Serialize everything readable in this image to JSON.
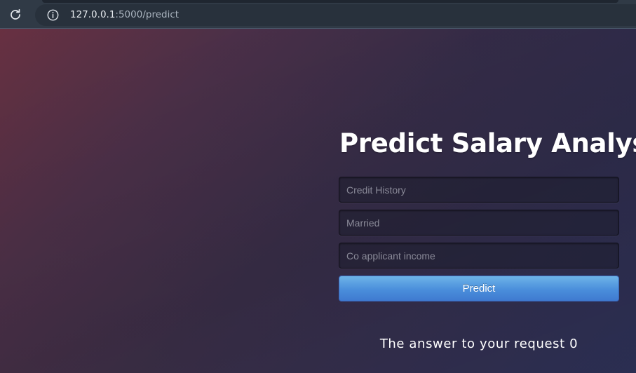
{
  "browser": {
    "url_host": "127.0.0.1",
    "url_path": ":5000/predict"
  },
  "page": {
    "title": "Predict Salary Analysis",
    "form": {
      "fields": [
        {
          "placeholder": "Credit History",
          "value": ""
        },
        {
          "placeholder": "Married",
          "value": ""
        },
        {
          "placeholder": "Co applicant income",
          "value": ""
        }
      ],
      "submit_label": "Predict"
    },
    "result_text": "The answer to your request 0"
  },
  "colors": {
    "button": "#4a8edb",
    "chrome": "#303a46"
  },
  "icons": {
    "reload": "reload-icon",
    "info": "info-icon"
  }
}
